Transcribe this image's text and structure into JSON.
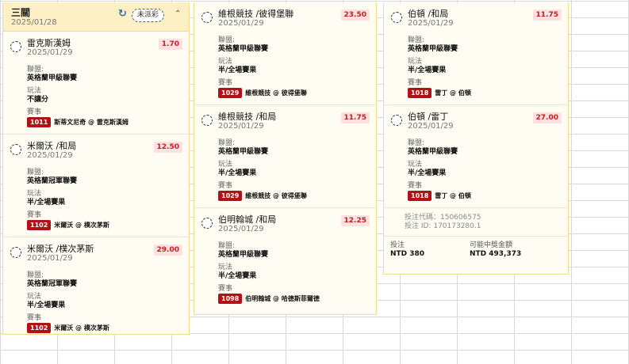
{
  "slip": {
    "title": "三關",
    "date": "2025/01/28",
    "status": "未派彩",
    "refresh_icon": "refresh-icon",
    "collapse_icon": "chevron-up-icon"
  },
  "labels": {
    "league": "聯盟:",
    "market": "玩法",
    "match": "賽事"
  },
  "columns": [
    {
      "bets": [
        {
          "selection": "雷克斯漢姆",
          "date": "2025/01/29",
          "odds": "1.70",
          "league": "英格蘭甲級聯賽",
          "market": "不讓分",
          "match_code": "1011",
          "match_name": "斯蒂文尼奇 @ 雷克斯漢姆"
        },
        {
          "selection": "米爾沃 /和局",
          "date": "2025/01/29",
          "odds": "12.50",
          "league": "英格蘭冠軍聯賽",
          "market": "半/全場賽果",
          "match_code": "1102",
          "match_name": "米爾沃 @ 樸次茅斯"
        },
        {
          "selection": "米爾沃 /樸次茅斯",
          "date": "2025/01/29",
          "odds": "29.00",
          "league": "英格蘭冠軍聯賽",
          "market": "半/全場賽果",
          "match_code": "1102",
          "match_name": "米爾沃 @ 樸次茅斯"
        }
      ]
    },
    {
      "bets": [
        {
          "selection": "維根競技 /彼得堡聯",
          "date": "2025/01/29",
          "odds": "23.50",
          "league": "英格蘭甲級聯賽",
          "market": "半/全場賽果",
          "match_code": "1029",
          "match_name": "維根競技 @ 彼得堡聯"
        },
        {
          "selection": "維根競技 /和局",
          "date": "2025/01/29",
          "odds": "11.75",
          "league": "英格蘭甲級聯賽",
          "market": "半/全場賽果",
          "match_code": "1029",
          "match_name": "維根競技 @ 彼得堡聯"
        },
        {
          "selection": "伯明翰城 /和局",
          "date": "2025/01/29",
          "odds": "12.25",
          "league": "英格蘭甲級聯賽",
          "market": "半/全場賽果",
          "match_code": "1098",
          "match_name": "伯明翰城 @ 哈德斯菲爾德"
        }
      ]
    },
    {
      "bets": [
        {
          "selection": "伯頓 /和局",
          "date": "2025/01/29",
          "odds": "11.75",
          "league": "英格蘭甲級聯賽",
          "market": "半/全場賽果",
          "match_code": "1018",
          "match_name": "雷丁 @ 伯頓"
        },
        {
          "selection": "伯頓 /雷丁",
          "date": "2025/01/29",
          "odds": "27.00",
          "league": "英格蘭甲級聯賽",
          "market": "半/全場賽果",
          "match_code": "1018",
          "match_name": "雷丁 @ 伯頓"
        }
      ]
    }
  ],
  "ids": {
    "bet_code": "投注代碼：150606575",
    "bet_id": "投注 ID: 170173280.1"
  },
  "totals": {
    "stake_label": "投注",
    "stake_value": "NTD 380",
    "payout_label": "可能中獎金額",
    "payout_value": "NTD 493,373"
  }
}
